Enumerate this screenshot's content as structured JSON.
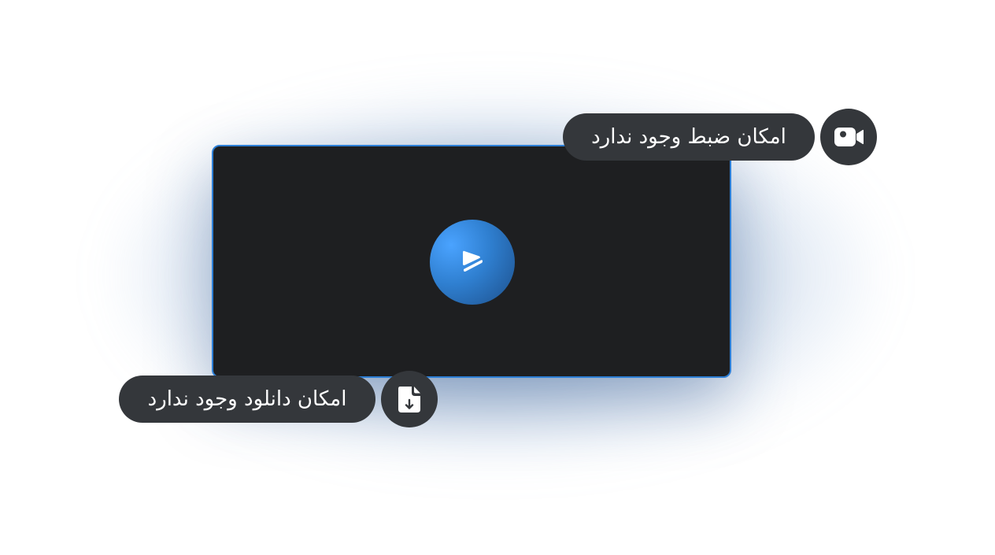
{
  "player": {
    "play_icon": "play-icon",
    "accent_color": "#2d7fd6"
  },
  "notices": {
    "record": {
      "label": "امکان ضبط وجود ندارد",
      "icon": "video-camera-icon"
    },
    "download": {
      "label": "امکان دانلود وجود ندارد",
      "icon": "file-download-icon"
    }
  }
}
